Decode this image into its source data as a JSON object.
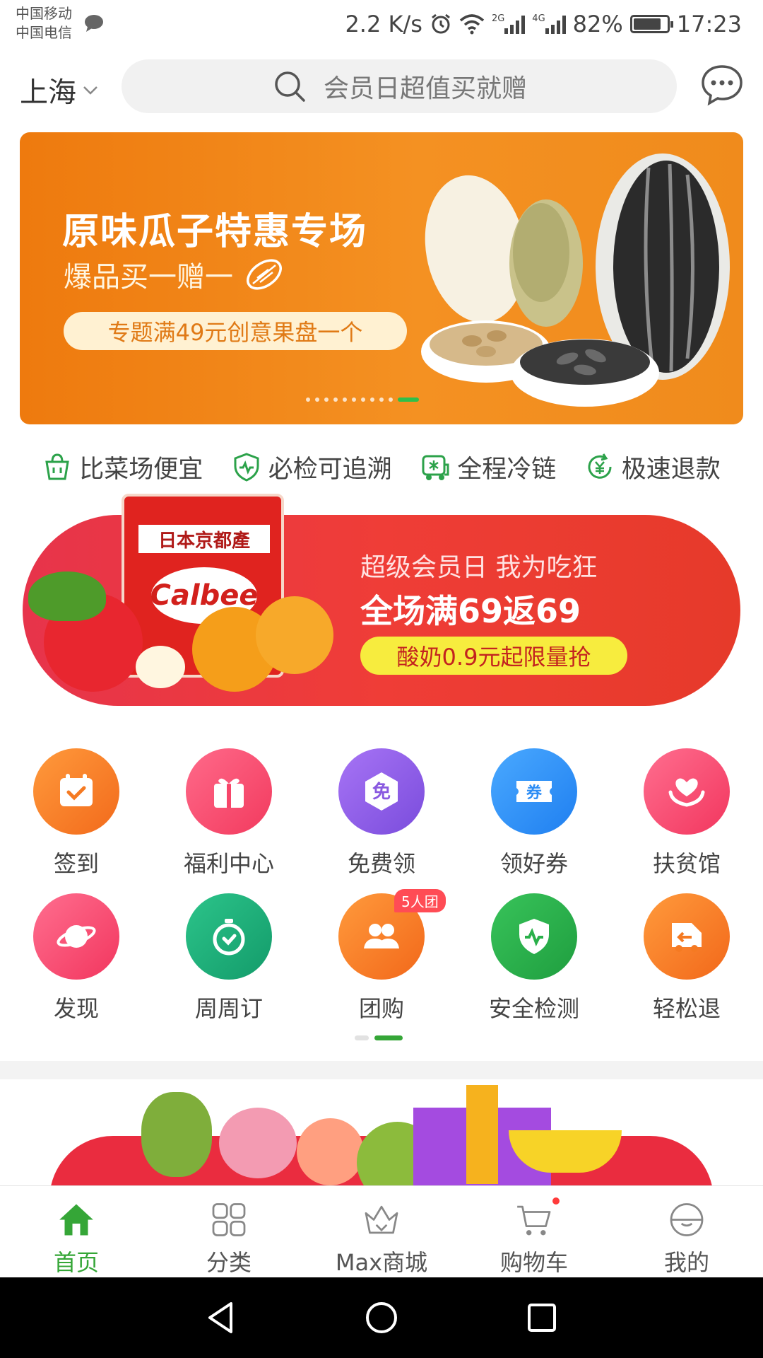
{
  "status_bar": {
    "carrier_1": "中国移动",
    "carrier_2": "中国电信",
    "speed": "2.2 K/s",
    "net_2g": "2G",
    "net_4g": "4G",
    "battery": "82%",
    "battery_level": 0.82,
    "time": "17:23"
  },
  "header": {
    "city": "上海",
    "search_placeholder": "会员日超值买就赠"
  },
  "banner_main": {
    "title": "原味瓜子特惠专场",
    "subtitle": "爆品买一赠一",
    "pill": "专题满49元创意果盘一个",
    "page_count": 11,
    "active_index": 10
  },
  "features": [
    {
      "icon": "basket-icon",
      "label": "比菜场便宜"
    },
    {
      "icon": "shield-check-icon",
      "label": "必检可追溯"
    },
    {
      "icon": "cold-truck-icon",
      "label": "全程冷链"
    },
    {
      "icon": "refund-icon",
      "label": "极速退款"
    }
  ],
  "banner_member": {
    "bag_label": "日本京都產",
    "bag_brand": "Calbee",
    "line1": "超级会员日 我为吃狂",
    "line2": "全场满69返69",
    "pill": "酸奶0.9元起限量抢"
  },
  "grid": {
    "row1": [
      {
        "icon": "calendar-check-icon",
        "label": "签到",
        "color": "#f57a22"
      },
      {
        "icon": "gift-icon",
        "label": "福利中心",
        "color": "#f7466a"
      },
      {
        "icon": "free-icon",
        "label": "免费领",
        "color": "#8a5ae0",
        "glyph": "免"
      },
      {
        "icon": "coupon-icon",
        "label": "领好券",
        "color": "#2c8df5",
        "glyph": "券"
      },
      {
        "icon": "heart-hands-icon",
        "label": "扶贫馆",
        "color": "#f94b72"
      }
    ],
    "row2": [
      {
        "icon": "planet-icon",
        "label": "发现",
        "color": "#f7466a"
      },
      {
        "icon": "stopwatch-icon",
        "label": "周周订",
        "color": "#21b07b"
      },
      {
        "icon": "group-icon",
        "label": "团购",
        "color": "#f97a1e",
        "badge": "5人团"
      },
      {
        "icon": "shield-pulse-icon",
        "label": "安全检测",
        "color": "#2ab04a"
      },
      {
        "icon": "return-truck-icon",
        "label": "轻松退",
        "color": "#f77a22"
      }
    ],
    "page_count": 2,
    "active_index": 1
  },
  "bottom_nav": {
    "items": [
      {
        "icon": "home-icon",
        "label": "首页",
        "active": true
      },
      {
        "icon": "category-icon",
        "label": "分类"
      },
      {
        "icon": "crown-icon",
        "label": "Max商城"
      },
      {
        "icon": "cart-icon",
        "label": "购物车"
      },
      {
        "icon": "profile-icon",
        "label": "我的"
      }
    ]
  },
  "colors": {
    "accent": "#35a637",
    "banner_orange": "#f28a1a",
    "banner_red": "#ea3a38"
  }
}
